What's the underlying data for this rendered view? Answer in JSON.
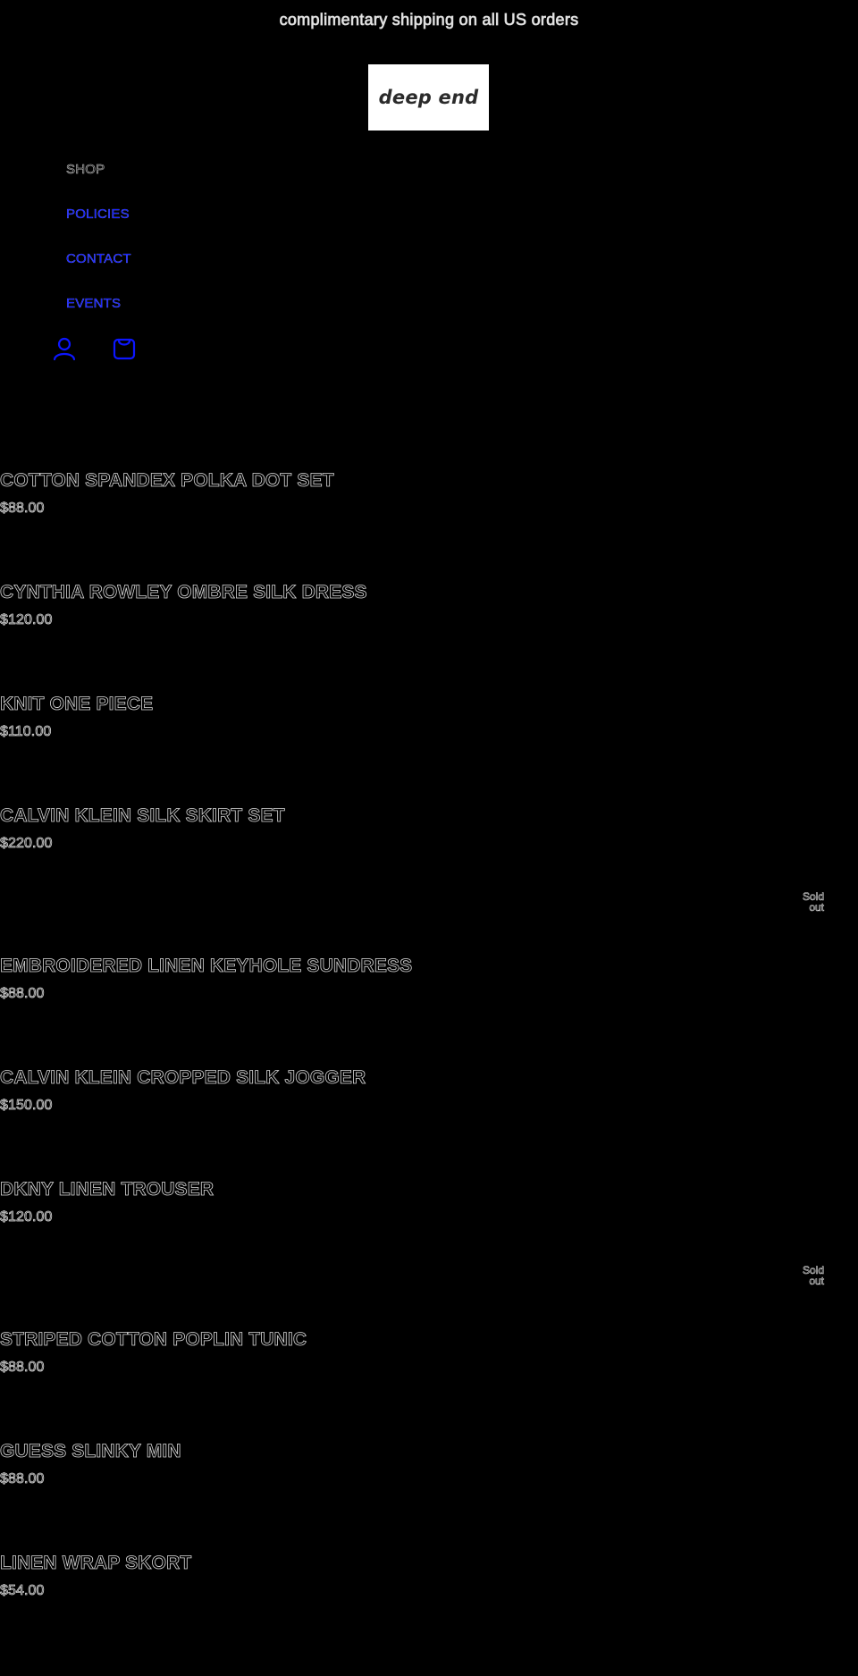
{
  "header": {
    "announcement": "complimentary shipping on all US orders",
    "logo_text": "deep end",
    "nav": [
      {
        "label": "SHOP"
      },
      {
        "label": "POLICIES"
      },
      {
        "label": "CONTACT"
      },
      {
        "label": "EVENTS"
      }
    ],
    "icons": [
      {
        "name": "account-icon"
      },
      {
        "name": "cart-icon"
      }
    ]
  },
  "products": [
    {
      "title": "COTTON SPANDEX POLKA DOT SET",
      "price": "$88.00"
    },
    {
      "title": "CYNTHIA ROWLEY OMBRE SILK DRESS",
      "price": "$120.00"
    },
    {
      "title": "KNIT ONE PIECE",
      "price": "$110.00"
    },
    {
      "title": "CALVIN KLEIN SILK SKIRT SET",
      "price": "$220.00"
    },
    {
      "title": "EMBROIDERED LINEN KEYHOLE SUNDRESS",
      "price": "$88.00"
    },
    {
      "title": "CALVIN KLEIN CROPPED SILK JOGGER",
      "price": "$150.00"
    },
    {
      "title": "DKNY LINEN TROUSER",
      "price": "$120.00"
    },
    {
      "title": "STRIPED COTTON POPLIN TUNIC",
      "price": "$88.00"
    },
    {
      "title": "GUESS SLINKY MIN",
      "price": "$88.00"
    },
    {
      "title": "LINEN WRAP SKORT",
      "price": "$54.00"
    }
  ],
  "sold_out_labels": [
    {
      "line1": "Sold",
      "line2": "out"
    },
    {
      "line1": "Sold",
      "line2": "out"
    }
  ]
}
